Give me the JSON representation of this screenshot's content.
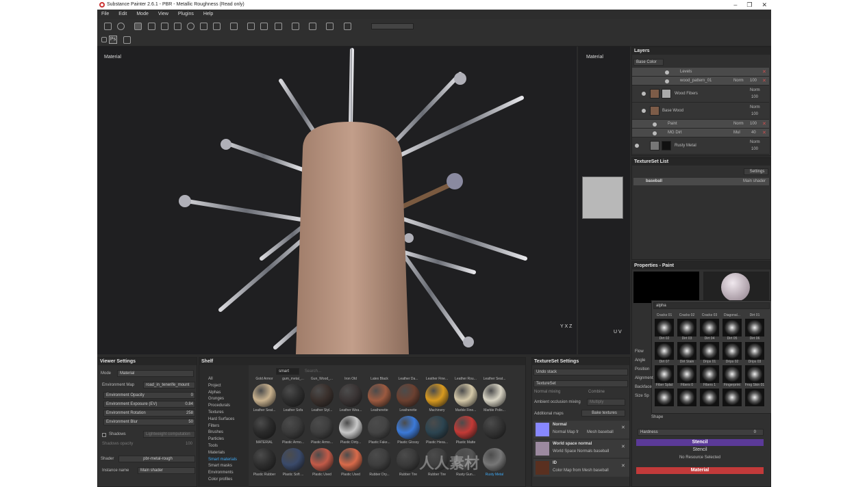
{
  "window": {
    "title": "Substance Painter 2.6.1 - PBR - Metallic Roughness (Read only)",
    "minimize": "–",
    "maximize": "❐",
    "close": "✕"
  },
  "menu": [
    "File",
    "Edit",
    "Mode",
    "View",
    "Plugins",
    "Help"
  ],
  "toolbar": {
    "ps_label": "Ps"
  },
  "viewport": {
    "label_3d": "Material",
    "label_2d": "Material",
    "axis_3d": "Y X Z",
    "axis_2d": "U V"
  },
  "layers": {
    "title": "Layers",
    "channel": "Base Color",
    "items": [
      {
        "name": "Levels",
        "blend": "",
        "opacity": ""
      },
      {
        "name": "wood_pattern_01",
        "blend": "Norm",
        "opacity": "100"
      },
      {
        "name": "Wood Fibers",
        "blend": "Norm",
        "opacity": "100"
      },
      {
        "name": "Base Wood",
        "blend": "Norm",
        "opacity": "100"
      },
      {
        "name": "Paint",
        "blend": "Norm",
        "opacity": "100"
      },
      {
        "name": "MG Dirt",
        "blend": "Mul",
        "opacity": "40"
      },
      {
        "name": "Rusty Metal",
        "blend": "Norm",
        "opacity": "100"
      }
    ]
  },
  "textureset_list": {
    "title": "TextureSet List",
    "settings": "Settings",
    "set_name": "baseball",
    "shader": "Main shader"
  },
  "properties": {
    "title": "Properties - Paint",
    "search": "alpha",
    "shape_label": "Shape",
    "hardness": "Hardness",
    "hardness_val": "0",
    "stencil": "Stencil",
    "stencil_sub": "Stencil",
    "no_resource": "No Resource Selected",
    "material": "Material",
    "side_labels": [
      "Flow",
      "Angle",
      "Position",
      "Alignment",
      "Backface",
      "Size Sp"
    ],
    "brushes": [
      "Cracks 01",
      "Cracks 02",
      "Cracks 03",
      "Diagonal...",
      "Dirt 01",
      "Dirt 02",
      "Dirt 03",
      "Dirt 04",
      "Dirt 05",
      "Dirt 06",
      "Dirt 07",
      "Dirt Stain",
      "Drips 01",
      "Drips 02",
      "Drips 03",
      "Fiber Splat",
      "Fibers 0",
      "Fibers 1",
      "Fingerprint",
      "Frog Skin 01"
    ]
  },
  "viewer_settings": {
    "title": "Viewer Settings",
    "mode_label": "Mode",
    "mode_val": "Material",
    "envmap_label": "Environment Map",
    "envmap_val": "road_in_tenerife_mount",
    "sliders": [
      {
        "label": "Environment Opacity",
        "value": "0"
      },
      {
        "label": "Environment Exposure (EV)",
        "value": "0.84"
      },
      {
        "label": "Environment Rotation",
        "value": "258"
      },
      {
        "label": "Environment Blur",
        "value": "50"
      }
    ],
    "shadows_label": "Shadows",
    "shadows_btn": "Lightweight computation",
    "shadows_opacity": "Shadows opacity",
    "shadows_opacity_val": "100",
    "shader_label": "Shader",
    "shader_val": "pbr-metal-rough",
    "instance_label": "Instance name",
    "instance_val": "Main shader"
  },
  "shelf": {
    "title": "Shelf",
    "filter": "smart",
    "search_placeholder": "Search...",
    "categories": [
      "All",
      "Project",
      "Alphas",
      "Grunges",
      "Procedurals",
      "Textures",
      "Hard Surfaces",
      "Filters",
      "Brushes",
      "Particles",
      "Tools",
      "Materials",
      "Smart materials",
      "Smart masks",
      "Environments",
      "Color profiles"
    ],
    "selected_category": "Smart materials",
    "top_labels": [
      "Gold Armor",
      "gum_metal_...",
      "Gun_Wood_...",
      "Iron Old",
      "Latex Black",
      "Leather Da...",
      "Leather Fine...",
      "Leather Rou...",
      "Leather Seat..."
    ],
    "row1": [
      "Leather Seat...",
      "Leather Sofa",
      "Leather Styl...",
      "Leather Wea...",
      "Leatherette",
      "Leatherette",
      "Machinery",
      "Marble Fine...",
      "Marble Polis..."
    ],
    "row2": [
      "MATERIAL",
      "Plastic Armo...",
      "Plastic Armo...",
      "Plastic Dirty...",
      "Plastic Fake...",
      "Plastic Glossy",
      "Plastic Hexa...",
      "Plastic Matte",
      ""
    ],
    "row3": [
      "Plastic Rubber",
      "Plastic Soft ...",
      "Plastic Used",
      "Plastic Used",
      "Rubber Dry...",
      "Rubber Tire",
      "Rubber Tire",
      "Rusty Gun...",
      "Rusty Metal"
    ]
  },
  "textureset_settings": {
    "title": "TextureSet Settings",
    "undo": "Undo stack",
    "textureset": "TextureSet",
    "normal_mixing": "Normal mixing",
    "normal_mixing_val": "Combine",
    "ao_mixing": "Ambient occlusion mixing",
    "ao_mixing_val": "Multiply",
    "additional_maps": "Additional maps",
    "bake": "Bake textures",
    "maps": [
      {
        "name": "Normal",
        "desc": "Normal Map fr",
        "mesh": "Mesh baseball",
        "color": "#8888ff"
      },
      {
        "name": "World space normal",
        "desc": "World Space Normals baseball",
        "mesh": "",
        "color": "#9c8aa0"
      },
      {
        "name": "ID",
        "desc": "Color Map from Mesh baseball",
        "mesh": "",
        "color": "#5a3020"
      }
    ]
  },
  "watermark": "人人素材"
}
